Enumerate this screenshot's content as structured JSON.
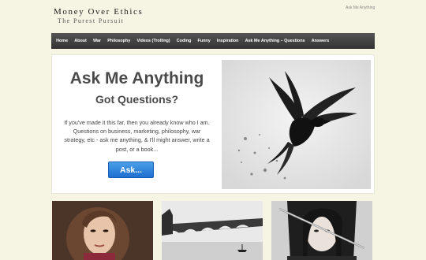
{
  "site": {
    "title": "Money Over Ethics",
    "tagline": "The Purest Pursuit",
    "top_link": "Ask Me Anything"
  },
  "nav": {
    "items": [
      {
        "label": "Home"
      },
      {
        "label": "About"
      },
      {
        "label": "War"
      },
      {
        "label": "Philosophy"
      },
      {
        "label": "Videos (Trolling)"
      },
      {
        "label": "Coding"
      },
      {
        "label": "Funny"
      },
      {
        "label": "Inspiration"
      },
      {
        "label": "Ask Me Anything – Questions"
      },
      {
        "label": "Answers"
      }
    ]
  },
  "hero": {
    "title": "Ask Me Anything",
    "subtitle": "Got Questions?",
    "body": "If you've made it this far, then you already know who I am. Questions on business, marketing, philosophy, war strategy, etc - ask me anything, & I'll might answer, write a post, or a book...",
    "button_label": "Ask...",
    "image_icon": "raven-image"
  },
  "thumbnails": [
    {
      "icon": "woman-portrait-image"
    },
    {
      "icon": "bridge-boat-image"
    },
    {
      "icon": "woman-sword-image"
    }
  ],
  "colors": {
    "page_bg": "#f6f5e3",
    "nav_bg": "#3f3f3f",
    "button": "#2a7fde",
    "text": "#4a4a4a"
  }
}
